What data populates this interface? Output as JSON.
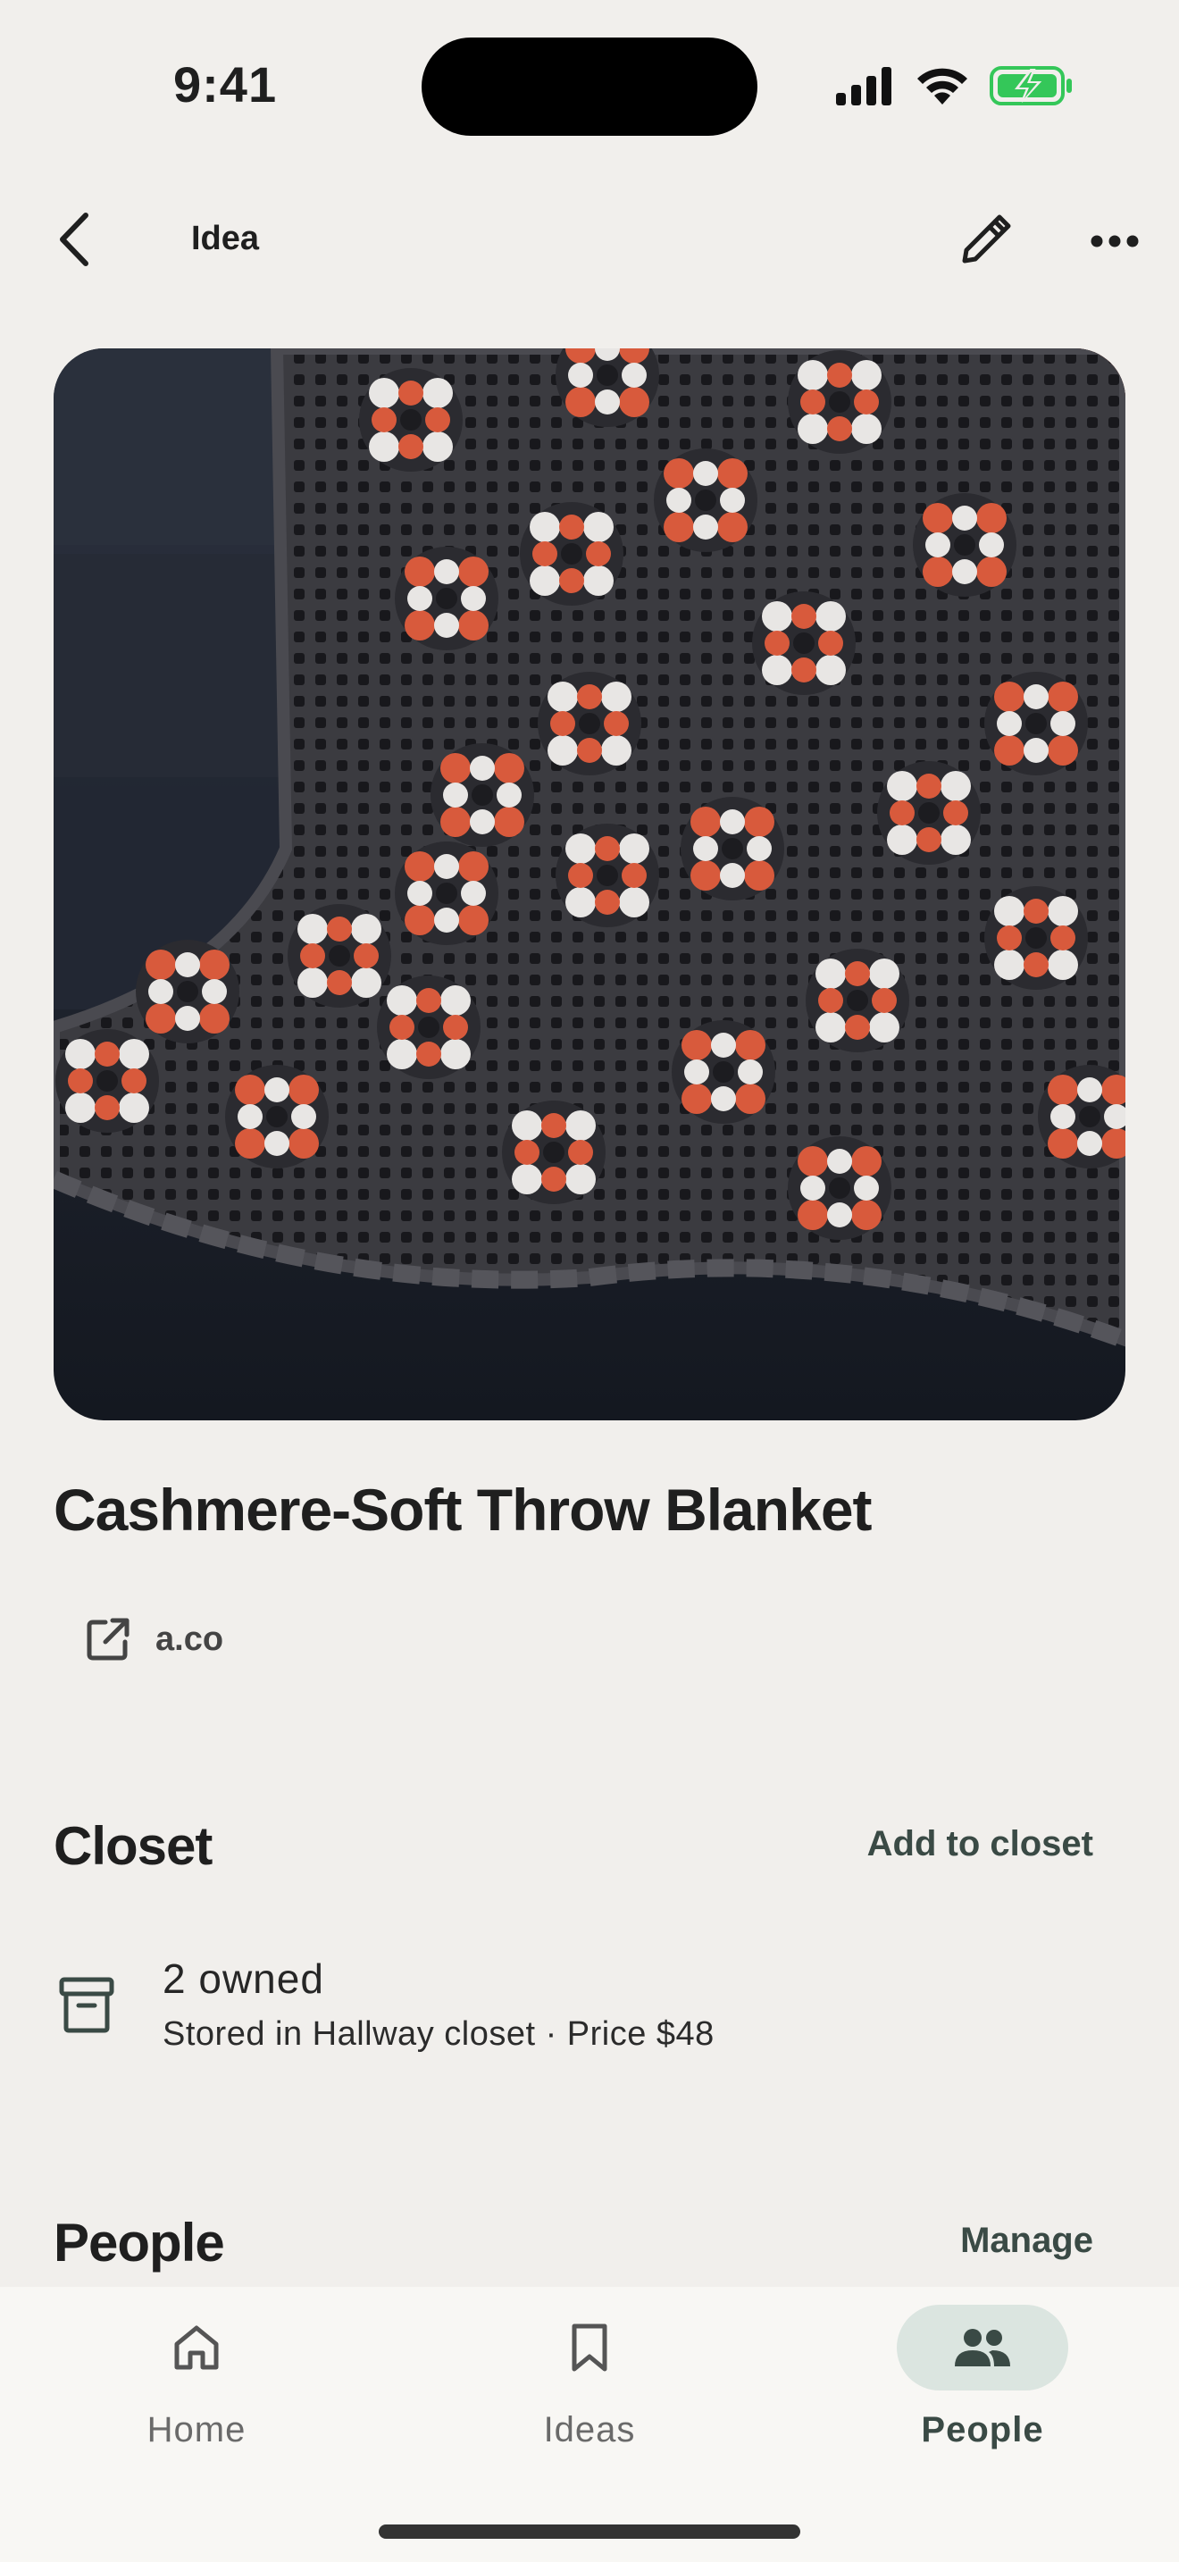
{
  "status_bar": {
    "time": "9:41"
  },
  "top_bar": {
    "title": "Idea"
  },
  "item": {
    "title": "Cashmere-Soft Throw Blanket",
    "link_text": "a.co"
  },
  "closet": {
    "section_title": "Closet",
    "action_label": "Add to closet",
    "owned_text": "2 owned",
    "details_text": "Stored in Hallway closet · Price $48"
  },
  "people": {
    "section_title": "People",
    "action_label": "Manage"
  },
  "bottom_nav": {
    "tabs": [
      {
        "label": "Home",
        "icon": "home-icon",
        "active": false
      },
      {
        "label": "Ideas",
        "icon": "bookmark-icon",
        "active": false
      },
      {
        "label": "People",
        "icon": "people-icon",
        "active": true
      }
    ]
  },
  "colors": {
    "background": "#f1efec",
    "nav_background": "#f8f7f4",
    "active_pill": "#dbe5e0",
    "accent_text": "#3a4a45",
    "battery_green": "#34c759"
  }
}
